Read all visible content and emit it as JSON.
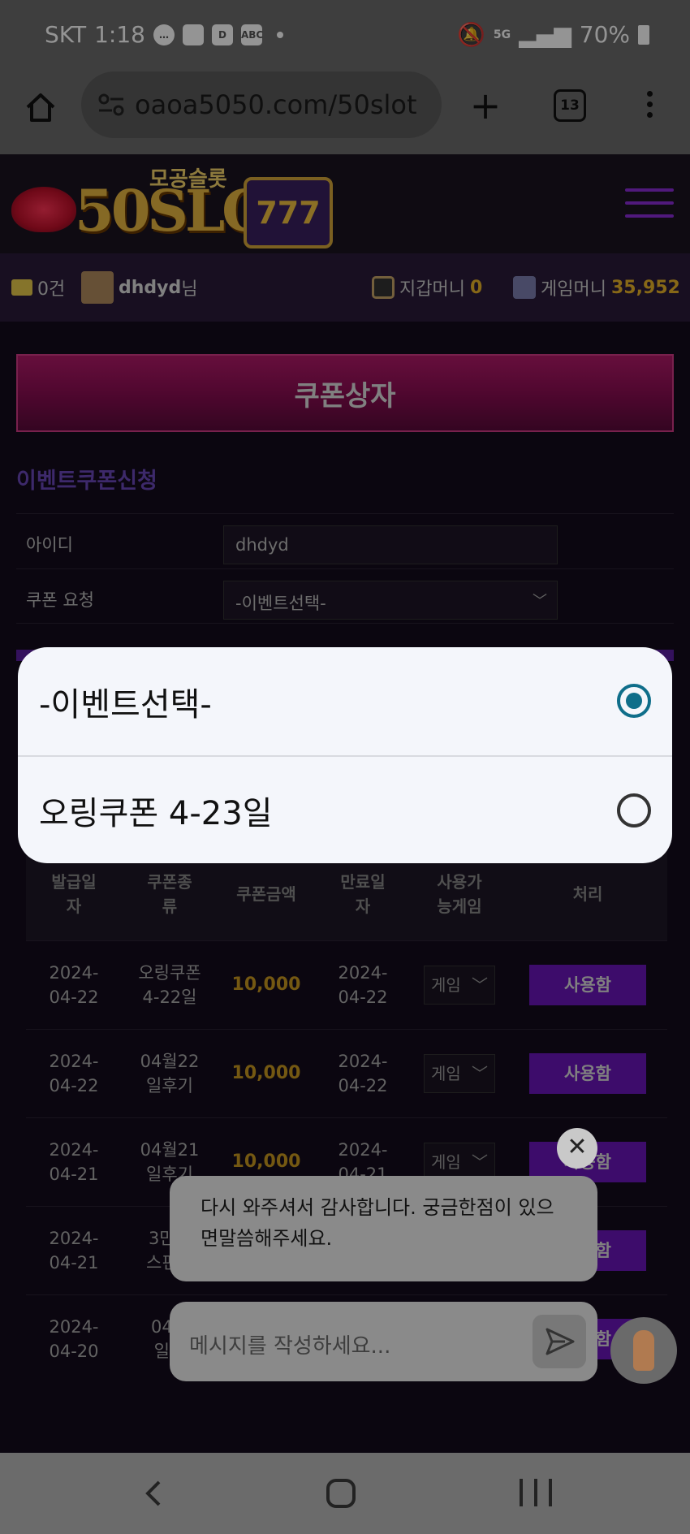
{
  "status_bar": {
    "carrier": "SKT",
    "time": "1:18",
    "notif_icons": [
      "chat-bubble-icon",
      "sticky-note-icon",
      "d-app-icon",
      "abc-icon"
    ],
    "network": "5G",
    "battery": "70%"
  },
  "browser": {
    "url": "oaoa5050.com/50slot",
    "tab_count": "13"
  },
  "site": {
    "logo_text": "50SLOT",
    "logo_sub": "모공슬롯",
    "logo_slot_text": "777"
  },
  "user_bar": {
    "mail_count": "0건",
    "username": "dhdyd",
    "username_suffix": "님",
    "wallet_label": "지갑머니",
    "wallet_value": "0",
    "game_label": "게임머니",
    "game_value": "35,952"
  },
  "coupon_box": {
    "title": "쿠폰상자"
  },
  "event_form": {
    "title": "이벤트쿠폰신청",
    "id_label": "아이디",
    "id_value": "dhdyd",
    "request_label": "쿠폰 요청",
    "request_value": "-이벤트선택-"
  },
  "table": {
    "headers": [
      "발급일\n자",
      "쿠폰종\n류",
      "쿠폰금액",
      "만료일\n자",
      "사용가\n능게임",
      "처리"
    ],
    "game_select_value": "게임",
    "action_label": "사용함",
    "rows": [
      {
        "issued": "2024-\n04-22",
        "type": "오링쿠폰\n4-22일",
        "amount": "10,000",
        "expires": "2024-\n04-22"
      },
      {
        "issued": "2024-\n04-22",
        "type": "04월22\n일후기",
        "amount": "10,000",
        "expires": "2024-\n04-22"
      },
      {
        "issued": "2024-\n04-21",
        "type": "04월21\n일후기",
        "amount": "10,000",
        "expires": "2024-\n04-21"
      },
      {
        "issued": "2024-\n04-21",
        "type": "3만포\n스핀후",
        "amount": "",
        "expires": ""
      },
      {
        "issued": "2024-\n04-20",
        "type": "04월\n일후",
        "amount": "",
        "expires": ""
      }
    ]
  },
  "dialog": {
    "options": [
      {
        "label": "-이벤트선택-",
        "checked": true
      },
      {
        "label": "오링쿠폰 4-23일",
        "checked": false
      }
    ]
  },
  "chat": {
    "message": "다시 와주셔서 감사합니다. 궁금한점이 있으면말씀해주세요.",
    "input_placeholder": "메시지를 작성하세요..."
  },
  "colors": {
    "accent_purple": "#6a16b8",
    "gold": "#e8b428",
    "coupon_pink": "#b01a68",
    "radio_teal": "#0f6e8a"
  }
}
